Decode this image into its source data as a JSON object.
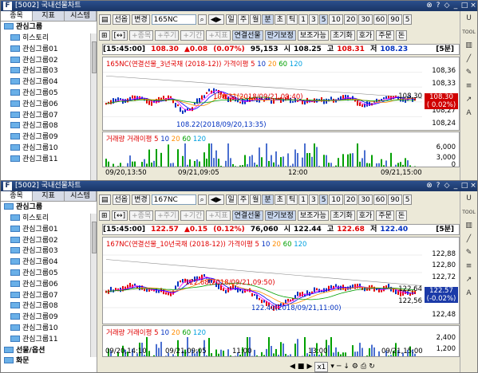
{
  "windows": [
    {
      "title": "[5002] 국내선물차트",
      "side_tabs": [
        "종목",
        "지표",
        "시스템"
      ],
      "group_label": "관심그룹",
      "folders": [
        "히스토리",
        "관심그룹01",
        "관심그룹02",
        "관심그룹03",
        "관심그룹04",
        "관심그룹05",
        "관심그룹06",
        "관심그룹07",
        "관심그룹08",
        "관심그룹09",
        "관심그룹10",
        "관심그룹11"
      ],
      "toolbar1": {
        "select1": "선옵",
        "select2": "변경",
        "ticker": "165NC",
        "buttons": [
          "일",
          "주",
          "월",
          "분",
          "초",
          "틱",
          "1",
          "3",
          "5",
          "10",
          "20",
          "30",
          "60",
          "90",
          "5"
        ]
      },
      "toolbar2": {
        "buttons": [
          "+종목",
          "+주기",
          "+기간",
          "+지표",
          "연결선물",
          "만기보정",
          "보조가능",
          "초기화",
          "호가",
          "주문",
          "돈"
        ]
      },
      "info": {
        "time": "[15:45:00]",
        "price": "108.30",
        "change": "▲0.08",
        "pct": "(0.07%)",
        "volume": "95,153",
        "high_label": "시",
        "high": "108.25",
        "h_label": "고",
        "h_val": "108.31",
        "l_label": "저",
        "l_val": "108.23",
        "period": "[5분]"
      },
      "legend_price": "165NC(연결선물_3년국채 (2018-12))",
      "legend_ma": [
        "가격이평 5",
        "10",
        "20",
        "60",
        "120"
      ],
      "yaxis": [
        "108,36",
        "108,33",
        "108,30",
        "108,27",
        "108,24"
      ],
      "current": {
        "price": "108.30",
        "pct": "( 0.02%)"
      },
      "annot_high": "108.31(2018/09/21,09:40)",
      "annot_low": "108.22(2018/09/20,13:35)",
      "legend_vol": [
        "거래량",
        "거래이평 5",
        "10",
        "20",
        "60",
        "120"
      ],
      "vol_y": [
        "6,000",
        "3,000",
        "0"
      ],
      "xaxis": [
        "09/20,13:50",
        "09/21,09:05",
        "12:00",
        "09/21,15:00"
      ]
    },
    {
      "title": "[5002] 국내선물차트",
      "side_tabs": [
        "종목",
        "지표",
        "시스템"
      ],
      "group_label": "관심그룹",
      "folders": [
        "히스토리",
        "관심그룹01",
        "관심그룹02",
        "관심그룹03",
        "관심그룹04",
        "관심그룹05",
        "관심그룹06",
        "관심그룹07",
        "관심그룹08",
        "관심그룹09",
        "관심그룹10",
        "관심그룹11"
      ],
      "extra": [
        "선물/옵션",
        "화문"
      ],
      "toolbar1": {
        "select1": "선옵",
        "select2": "변경",
        "ticker": "167NC",
        "buttons": [
          "일",
          "주",
          "월",
          "분",
          "초",
          "틱",
          "1",
          "3",
          "5",
          "10",
          "20",
          "30",
          "60",
          "90",
          "5"
        ]
      },
      "toolbar2": {
        "buttons": [
          "+종목",
          "+주기",
          "+기간",
          "+지표",
          "연결선물",
          "만기보정",
          "보조가능",
          "초기화",
          "호가",
          "주문",
          "돈"
        ]
      },
      "info": {
        "time": "[15:45:00]",
        "price": "122.57",
        "change": "▲0.15",
        "pct": "(0.12%)",
        "volume": "76,060",
        "high_label": "시",
        "high": "122.44",
        "h_label": "고",
        "h_val": "122.68",
        "l_label": "저",
        "l_val": "122.40",
        "period": "[5분]"
      },
      "legend_price": "167NC(연결선물_10년국채 (2018-12))",
      "legend_ma": [
        "가격이평 5",
        "10",
        "20",
        "60",
        "120"
      ],
      "yaxis": [
        "122,88",
        "122,80",
        "122,72",
        "122,64",
        "122,56",
        "122,48"
      ],
      "current": {
        "price": "122.57",
        "pct": "(-0.02%)"
      },
      "annot_high": "122.68(2018/09/21,09:50)",
      "annot_low": "122.40(2018/09/21,11:00)",
      "legend_vol": [
        "거래량",
        "거래이평 5",
        "10",
        "20",
        "60",
        "120"
      ],
      "vol_y": [
        "2,400",
        "1,200"
      ],
      "xaxis": [
        "09/20,14:10",
        "09/21,09:05",
        "11:00",
        "13:00",
        "09/21,15:00"
      ],
      "bottom": [
        "x1"
      ]
    }
  ],
  "colors": {
    "up": "#e00000",
    "down": "#0030c0",
    "ma5": "#ff00ff",
    "ma10": "#0000ff",
    "ma20": "#ff8c00",
    "ma60": "#00a000",
    "ma120": "#00a0e0"
  },
  "right_icons": [
    "U",
    "TOOL",
    "chart-icon",
    "line-icon",
    "pen-icon",
    "fib-icon",
    "arrow-icon",
    "text-icon"
  ]
}
